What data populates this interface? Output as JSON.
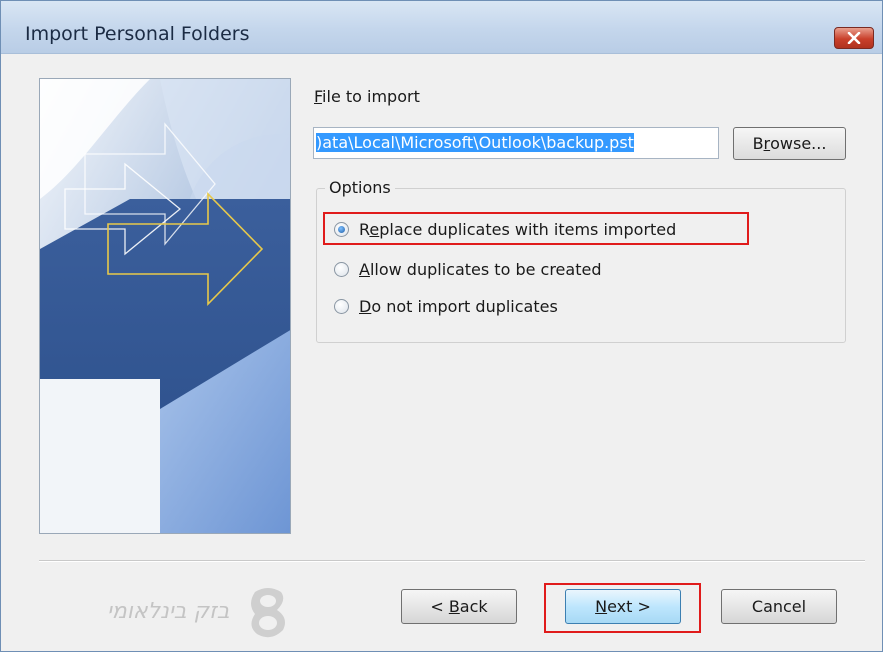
{
  "window": {
    "title": "Import Personal Folders"
  },
  "file": {
    "label_accel": "F",
    "label_rest": "ile to import",
    "path_value": ")ata\\Local\\Microsoft\\Outlook\\backup.pst"
  },
  "browse": {
    "pre": "B",
    "accel": "r",
    "post": "owse..."
  },
  "options": {
    "group_label": "Options",
    "items": [
      {
        "pre": "R",
        "accel": "e",
        "post": "place duplicates with items imported",
        "selected": true
      },
      {
        "pre": "",
        "accel": "A",
        "post": "llow duplicates to be created",
        "selected": false
      },
      {
        "pre": "",
        "accel": "D",
        "post": "o not import duplicates",
        "selected": false
      }
    ]
  },
  "buttons": {
    "back": {
      "pre": "< ",
      "accel": "B",
      "post": "ack"
    },
    "next": {
      "pre": "",
      "accel": "N",
      "post": "ext >"
    },
    "cancel": {
      "label": "Cancel"
    }
  },
  "watermark": {
    "text": "בזק בינלאומי"
  },
  "colors": {
    "highlight": "#e01b1b",
    "selection": "#3399ff",
    "titlebar": "#c4d6ec"
  }
}
